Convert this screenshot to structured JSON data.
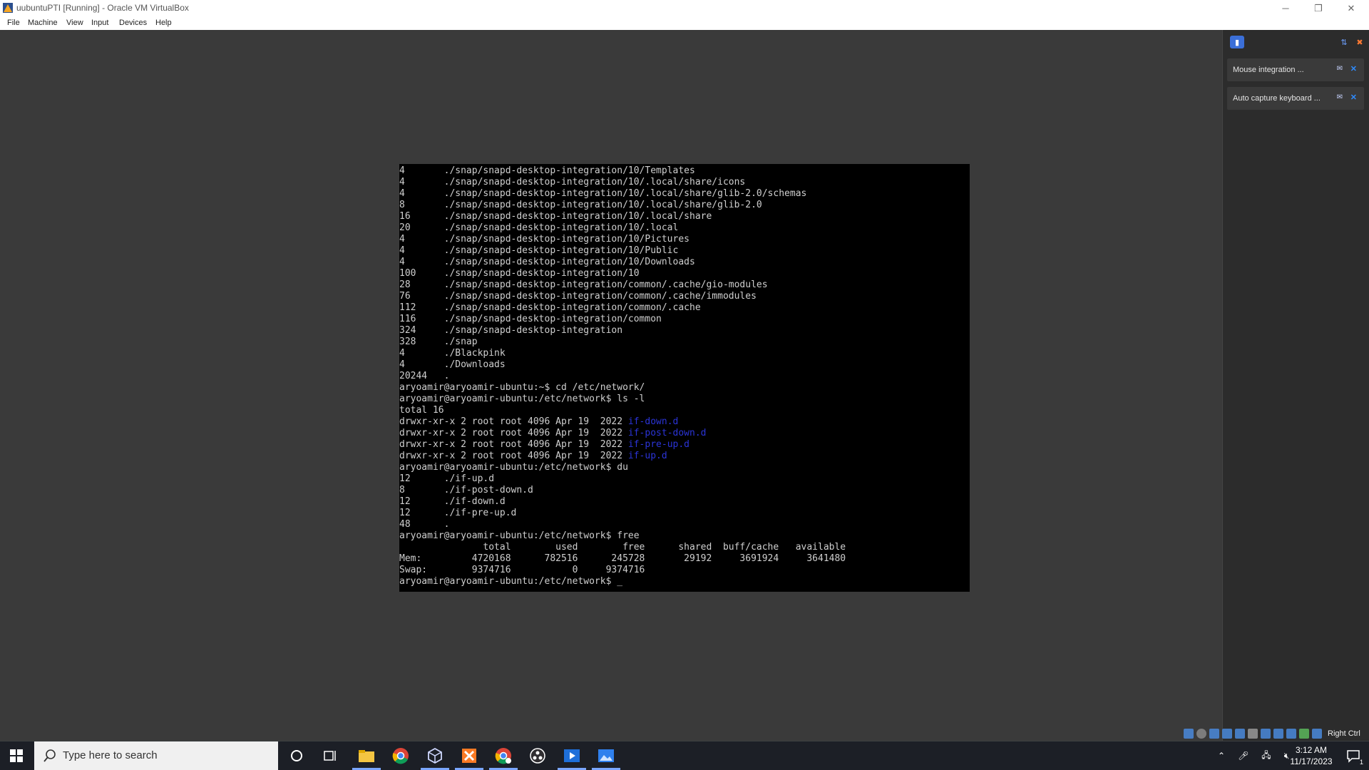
{
  "window": {
    "title": "uubuntuPTI [Running] - Oracle VM VirtualBox",
    "controls": {
      "minimize": "─",
      "restore": "❐",
      "close": "✕"
    }
  },
  "menubar": [
    "File",
    "Machine",
    "View",
    "Input",
    "Devices",
    "Help"
  ],
  "terminal": {
    "lines": [
      "4       ./snap/snapd-desktop-integration/10/Templates",
      "4       ./snap/snapd-desktop-integration/10/.local/share/icons",
      "4       ./snap/snapd-desktop-integration/10/.local/share/glib-2.0/schemas",
      "8       ./snap/snapd-desktop-integration/10/.local/share/glib-2.0",
      "16      ./snap/snapd-desktop-integration/10/.local/share",
      "20      ./snap/snapd-desktop-integration/10/.local",
      "4       ./snap/snapd-desktop-integration/10/Pictures",
      "4       ./snap/snapd-desktop-integration/10/Public",
      "4       ./snap/snapd-desktop-integration/10/Downloads",
      "100     ./snap/snapd-desktop-integration/10",
      "28      ./snap/snapd-desktop-integration/common/.cache/gio-modules",
      "76      ./snap/snapd-desktop-integration/common/.cache/immodules",
      "112     ./snap/snapd-desktop-integration/common/.cache",
      "116     ./snap/snapd-desktop-integration/common",
      "324     ./snap/snapd-desktop-integration",
      "328     ./snap",
      "4       ./Blackpink",
      "4       ./Downloads",
      "20244   .",
      "aryoamir@aryoamir-ubuntu:~$ cd /etc/network/",
      "aryoamir@aryoamir-ubuntu:/etc/network$ ls -l",
      "total 16",
      "drwxr-xr-x 2 root root 4096 Apr 19  2022 ",
      "drwxr-xr-x 2 root root 4096 Apr 19  2022 ",
      "drwxr-xr-x 2 root root 4096 Apr 19  2022 ",
      "drwxr-xr-x 2 root root 4096 Apr 19  2022 ",
      "aryoamir@aryoamir-ubuntu:/etc/network$ du",
      "12      ./if-up.d",
      "8       ./if-post-down.d",
      "12      ./if-down.d",
      "12      ./if-pre-up.d",
      "48      .",
      "aryoamir@aryoamir-ubuntu:/etc/network$ free",
      "               total        used        free      shared  buff/cache   available",
      "Mem:         4720168      782516      245728       29192     3691924     3641480",
      "Swap:        9374716           0     9374716",
      "aryoamir@aryoamir-ubuntu:/etc/network$ "
    ],
    "dir_names": [
      "if-down.d",
      "if-post-down.d",
      "if-pre-up.d",
      "if-up.d"
    ],
    "cursor": "_",
    "colors": {
      "background": "#000000",
      "text": "#cfcfcf",
      "directory": "#2b34d8"
    }
  },
  "notifications": [
    {
      "text": "Mouse integration ...",
      "close": "✕"
    },
    {
      "text": "Auto capture keyboard ...",
      "close": "✕"
    }
  ],
  "status_bar": {
    "host_key": "Right Ctrl"
  },
  "taskbar": {
    "search_placeholder": "Type here to search",
    "clock_time": "3:12 AM",
    "clock_date": "11/17/2023",
    "notification_count": "1",
    "pinned": [
      "file-explorer",
      "chrome",
      "virtualbox",
      "xampp",
      "chrome-profile",
      "obs",
      "media-player",
      "photos"
    ]
  }
}
